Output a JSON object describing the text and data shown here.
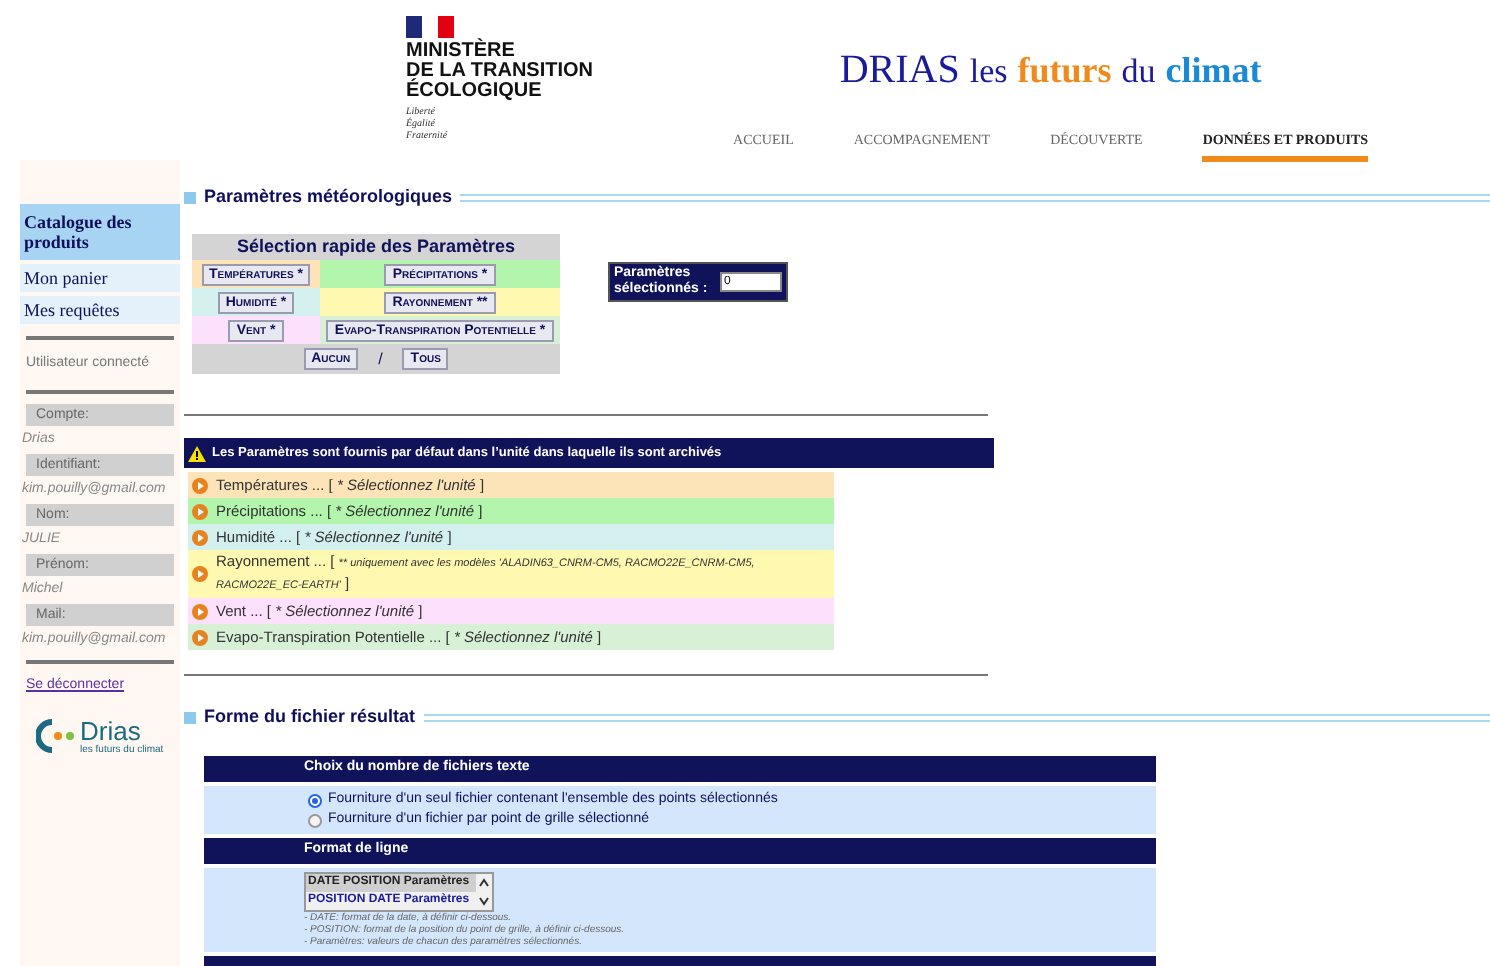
{
  "header": {
    "ministry": [
      "MINISTÈRE",
      "DE LA TRANSITION",
      "ÉCOLOGIQUE"
    ],
    "motto": [
      "Liberté",
      "Égalité",
      "Fraternité"
    ],
    "title": [
      {
        "text": "DRIAS",
        "color": "#1a1a9a"
      },
      {
        "text": "les",
        "color": "#1a1a9a"
      },
      {
        "text": "futurs",
        "color": "#f08a1c"
      },
      {
        "text": "du",
        "color": "#1a1a9a"
      },
      {
        "text": "climat",
        "color": "#1a8ad4"
      }
    ],
    "nav": [
      {
        "label": "ACCUEIL",
        "selected": false
      },
      {
        "label": "ACCOMPAGNEMENT",
        "selected": false
      },
      {
        "label": "DÉCOUVERTE",
        "selected": false
      },
      {
        "label": "DONNÉES ET PRODUITS",
        "selected": true
      }
    ]
  },
  "sidebar": {
    "items": [
      {
        "label": "Catalogue des produits",
        "selected": true
      },
      {
        "label": "Mon panier",
        "selected": false
      },
      {
        "label": "Mes requêtes",
        "selected": false
      }
    ],
    "user_title": "Utilisateur connecté",
    "fields": [
      {
        "label": "Compte:",
        "value": "Drias"
      },
      {
        "label": "Identifiant:",
        "value": "kim.pouilly@gmail.com"
      },
      {
        "label": "Nom:",
        "value": "JULIE"
      },
      {
        "label": "Prénom:",
        "value": "Michel"
      },
      {
        "label": "Mail:",
        "value": "kim.pouilly@gmail.com"
      }
    ],
    "logout": "Se déconnecter",
    "logo_name": "Drias",
    "logo_tagline": "les futurs du climat"
  },
  "meteo": {
    "title": "Paramètres météorologiques",
    "quick": {
      "title": "Sélection rapide des Paramètres",
      "rows": [
        [
          {
            "label": "Températures *",
            "color": "#fde3b8"
          },
          {
            "label": "Précipitations *",
            "color": "#b3f5ad"
          }
        ],
        [
          {
            "label": "Humidité *",
            "color": "#d3f0ee"
          },
          {
            "label": "Rayonnement **",
            "color": "#fff8b0"
          }
        ],
        [
          {
            "label": "Vent *",
            "color": "#fde0fb"
          },
          {
            "label": "Evapo-Transpiration Potentielle *",
            "color": "#d8f0d5"
          }
        ]
      ],
      "none": "Aucun",
      "separator": "/",
      "all": "Tous"
    },
    "count_label": "Paramètres sélectionnés :",
    "count": "0",
    "warning": "Les Paramètres sont fournis par défaut dans l’unité dans laquelle ils sont archivés",
    "params": [
      {
        "name": "Températures ... [",
        "note": "* Sélectionnez l'unité",
        "end": "]",
        "color": "#fde3b8",
        "kind": "normal"
      },
      {
        "name": "Précipitations ... [",
        "note": "* Sélectionnez l'unité",
        "end": "]",
        "color": "#b3f5ad",
        "kind": "normal"
      },
      {
        "name": "Humidité ... [",
        "note": "* Sélectionnez l'unité",
        "end": "]",
        "color": "#d3f0ee",
        "kind": "normal"
      },
      {
        "name": "Rayonnement ... [",
        "note": "** uniquement avec les modèles 'ALADIN63_CNRM-CM5, RACMO22E_CNRM-CM5, RACMO22E_EC-EARTH'",
        "end": "]",
        "color": "#fff8b0",
        "kind": "small"
      },
      {
        "name": "Vent ... [",
        "note": "* Sélectionnez l'unité",
        "end": "]",
        "color": "#fde0fb",
        "kind": "normal"
      },
      {
        "name": "Evapo-Transpiration Potentielle ... [",
        "note": "* Sélectionnez l'unité",
        "end": "]",
        "color": "#d8f0d5",
        "kind": "normal"
      }
    ]
  },
  "output": {
    "title": "Forme du fichier résultat",
    "files_title": "Choix du nombre de fichiers texte",
    "files": [
      {
        "label": "Fourniture d'un seul fichier contenant l'ensemble des points sélectionnés",
        "selected": true
      },
      {
        "label": "Fourniture d'un fichier par point de grille sélectionné",
        "selected": false
      }
    ],
    "format_title": "Format de ligne",
    "formats": [
      {
        "label": "DATE POSITION Paramètres",
        "selected": true
      },
      {
        "label": "POSITION DATE Paramètres",
        "selected": false
      }
    ],
    "notes": [
      "- DATE: format de la date, à définir ci-dessous.",
      "- POSITION: format de la position du point de grille, à définir ci-dessous.",
      "- Paramètres: valeurs de chacun des paramètres sélectionnés."
    ]
  }
}
